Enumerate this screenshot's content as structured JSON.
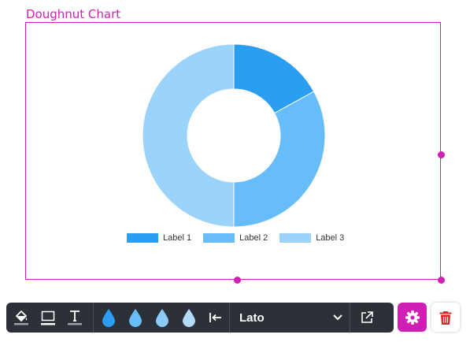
{
  "widget": {
    "title": "Doughnut Chart"
  },
  "chart_data": {
    "type": "doughnut",
    "categories": [
      "Label 1",
      "Label 2",
      "Label 3"
    ],
    "values": [
      17,
      33,
      50
    ],
    "colors": [
      "#2b9ef2",
      "#66bdfa",
      "#9cd3fb"
    ],
    "legend_position": "bottom"
  },
  "toolbar": {
    "icons": [
      "paint-bucket-icon",
      "border-icon",
      "text-icon",
      "droplet-icon",
      "droplet-icon",
      "droplet-icon",
      "droplet-icon",
      "align-left-icon",
      "external-link-icon"
    ],
    "droplet_colors": [
      "#2b9ef2",
      "#66bdfa",
      "#8ccaf8",
      "#b3dcfb"
    ],
    "font_value": "Lato"
  },
  "colors": {
    "accent": "#d01fb5",
    "toolbar_bg": "#2c3138",
    "delete": "#e0262b"
  }
}
